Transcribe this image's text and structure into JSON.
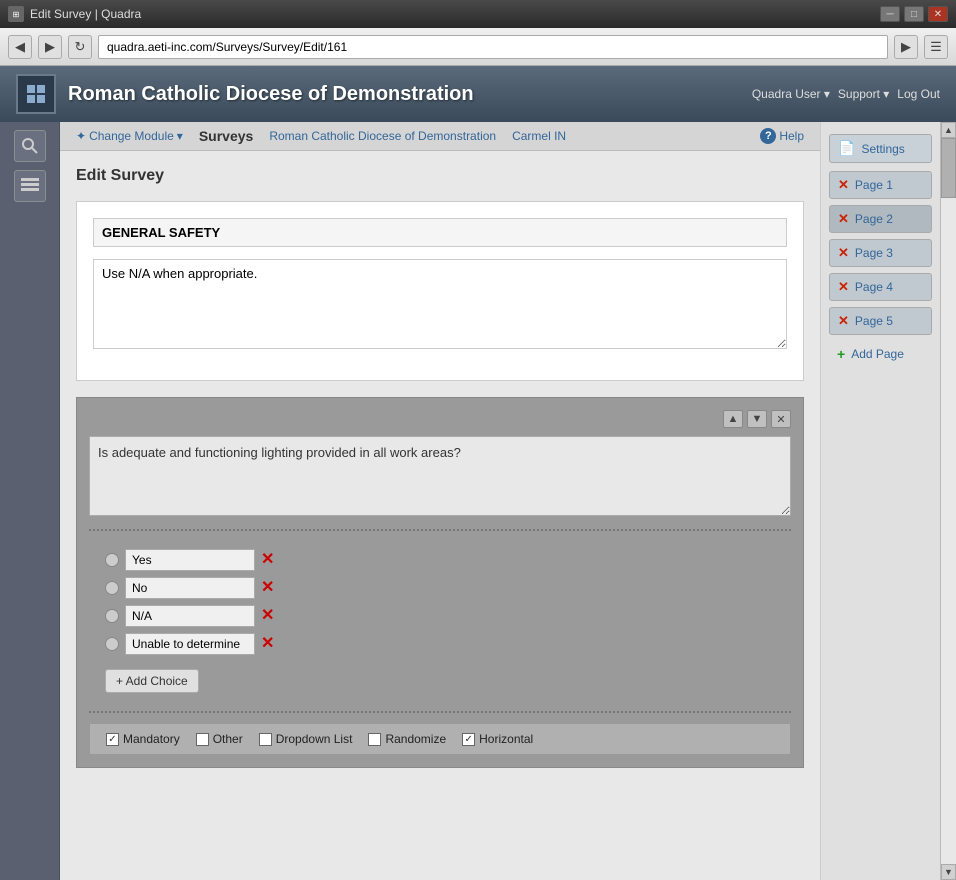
{
  "browser": {
    "title": "Edit Survey | Quadra",
    "url": "quadra.aeti-inc.com/Surveys/Survey/Edit/161",
    "back_icon": "◀",
    "forward_icon": "▶",
    "refresh_icon": "↻",
    "menu_icon": "☰",
    "more_icon": "▶"
  },
  "header": {
    "title": "Roman Catholic Diocese of Demonstration",
    "nav": [
      {
        "label": "Quadra User ▾"
      },
      {
        "label": "Support ▾"
      },
      {
        "label": "Log Out"
      }
    ]
  },
  "breadcrumb": {
    "change_module": "Change Module",
    "surveys": "Surveys",
    "diocese": "Roman Catholic Diocese of Demonstration",
    "location": "Carmel IN",
    "help": "Help"
  },
  "page": {
    "title": "Edit Survey"
  },
  "survey": {
    "title": "GENERAL SAFETY",
    "description": "Use N/A when appropriate."
  },
  "question": {
    "text": "Is adequate and functioning lighting provided in all work areas?",
    "up_btn": "▲",
    "down_btn": "▼",
    "close_btn": "✕",
    "choices": [
      {
        "label": "Yes"
      },
      {
        "label": "No"
      },
      {
        "label": "N/A"
      },
      {
        "label": "Unable to determine"
      }
    ],
    "add_choice_btn": "+ Add Choice",
    "options": [
      {
        "key": "mandatory",
        "label": "Mandatory",
        "checked": true
      },
      {
        "key": "other",
        "label": "Other",
        "checked": false
      },
      {
        "key": "dropdown_list",
        "label": "Dropdown List",
        "checked": false
      },
      {
        "key": "randomize",
        "label": "Randomize",
        "checked": false
      },
      {
        "key": "horizontal",
        "label": "Horizontal",
        "checked": true
      }
    ]
  },
  "right_sidebar": {
    "settings_label": "Settings",
    "pages": [
      {
        "label": "Page 1"
      },
      {
        "label": "Page 2"
      },
      {
        "label": "Page 3"
      },
      {
        "label": "Page 4"
      },
      {
        "label": "Page 5"
      }
    ],
    "add_page_label": "Add Page"
  }
}
